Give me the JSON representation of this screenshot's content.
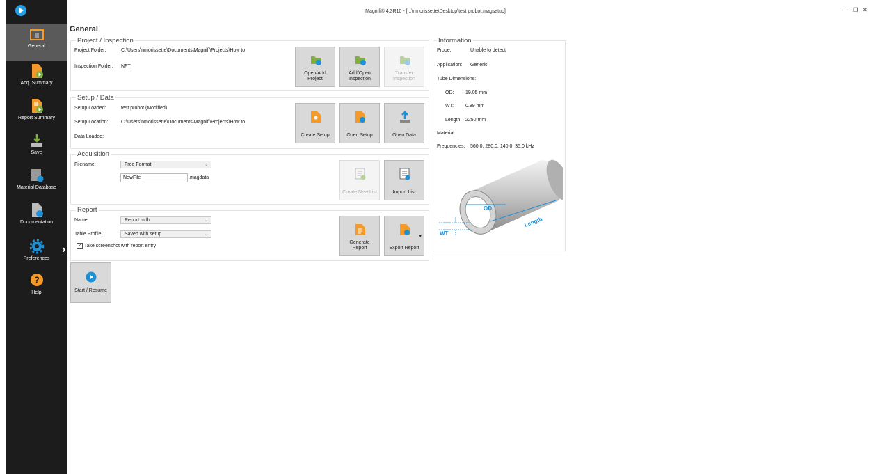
{
  "window": {
    "title": "Magnifi® 4.3R10 - [...\\nmorissette\\Desktop\\test probot.magsetup]",
    "minimize": "–",
    "restore": "❐",
    "close": "✕"
  },
  "sidebar": {
    "items": [
      {
        "label": "General"
      },
      {
        "label": "Acq. Summary"
      },
      {
        "label": "Report Summary"
      },
      {
        "label": "Save"
      },
      {
        "label": "Material Database"
      },
      {
        "label": "Documentation"
      },
      {
        "label": "Preferences"
      },
      {
        "label": "Help"
      }
    ],
    "expand_glyph": "›"
  },
  "page_title": "General",
  "project": {
    "title": "Project / Inspection",
    "folder_label": "Project Folder:",
    "folder_value": "C:\\Users\\nmorissette\\Documents\\Magnifi\\Projects\\How to",
    "inspection_label": "Inspection Folder:",
    "inspection_value": "NFT",
    "btn_open_add": [
      "Open/Add",
      "Project"
    ],
    "btn_add_open": [
      "Add/Open",
      "Inspection"
    ],
    "btn_transfer": [
      "Transfer",
      "Inspection"
    ]
  },
  "setup": {
    "title": "Setup / Data",
    "loaded_label": "Setup Loaded:",
    "loaded_value": "test probot (Modified)",
    "location_label": "Setup Location:",
    "location_value": "C:\\Users\\nmorissette\\Documents\\Magnifi\\Projects\\How to",
    "data_label": "Data Loaded:",
    "btn_create": "Create Setup",
    "btn_open": "Open Setup",
    "btn_data": "Open Data"
  },
  "acquisition": {
    "title": "Acquisition",
    "filename_label": "Filename:",
    "format_value": "Free Format",
    "file_value": "NewFile",
    "extension": ".magdata",
    "btn_create_list": "Create New List",
    "btn_import_list": "Import List"
  },
  "report": {
    "title": "Report",
    "name_label": "Name:",
    "name_value": "Report.mdb",
    "profile_label": "Table Profile:",
    "profile_value": "Saved with setup",
    "screenshot_label": "Take screenshot with report entry",
    "screenshot_checked": "✓",
    "btn_generate": [
      "Generate",
      "Report"
    ],
    "btn_export": "Export Report"
  },
  "start_button": "Start / Resume",
  "info": {
    "title": "Information",
    "probe_label": "Probe:",
    "probe_value": "Unable to detect",
    "app_label": "Application:",
    "app_value": "Generic",
    "tube_label": "Tube Dimensions:",
    "od_label": "OD:",
    "od_value": "19.05 mm",
    "wt_label": "WT:",
    "wt_value": "0.89 mm",
    "length_label": "Length:",
    "length_value": "2250 mm",
    "material_label": "Material:",
    "freq_label": "Frequencies:",
    "freq_value": "560.0, 280.0, 140.0, 35.0 kHz",
    "diagram_od": "OD",
    "diagram_wt": "WT",
    "diagram_length": "Length"
  },
  "colors": {
    "orange": "#f39a2a",
    "green": "#7fae3a",
    "blue": "#1e90d6",
    "sidebar": "#1c1c1c"
  }
}
